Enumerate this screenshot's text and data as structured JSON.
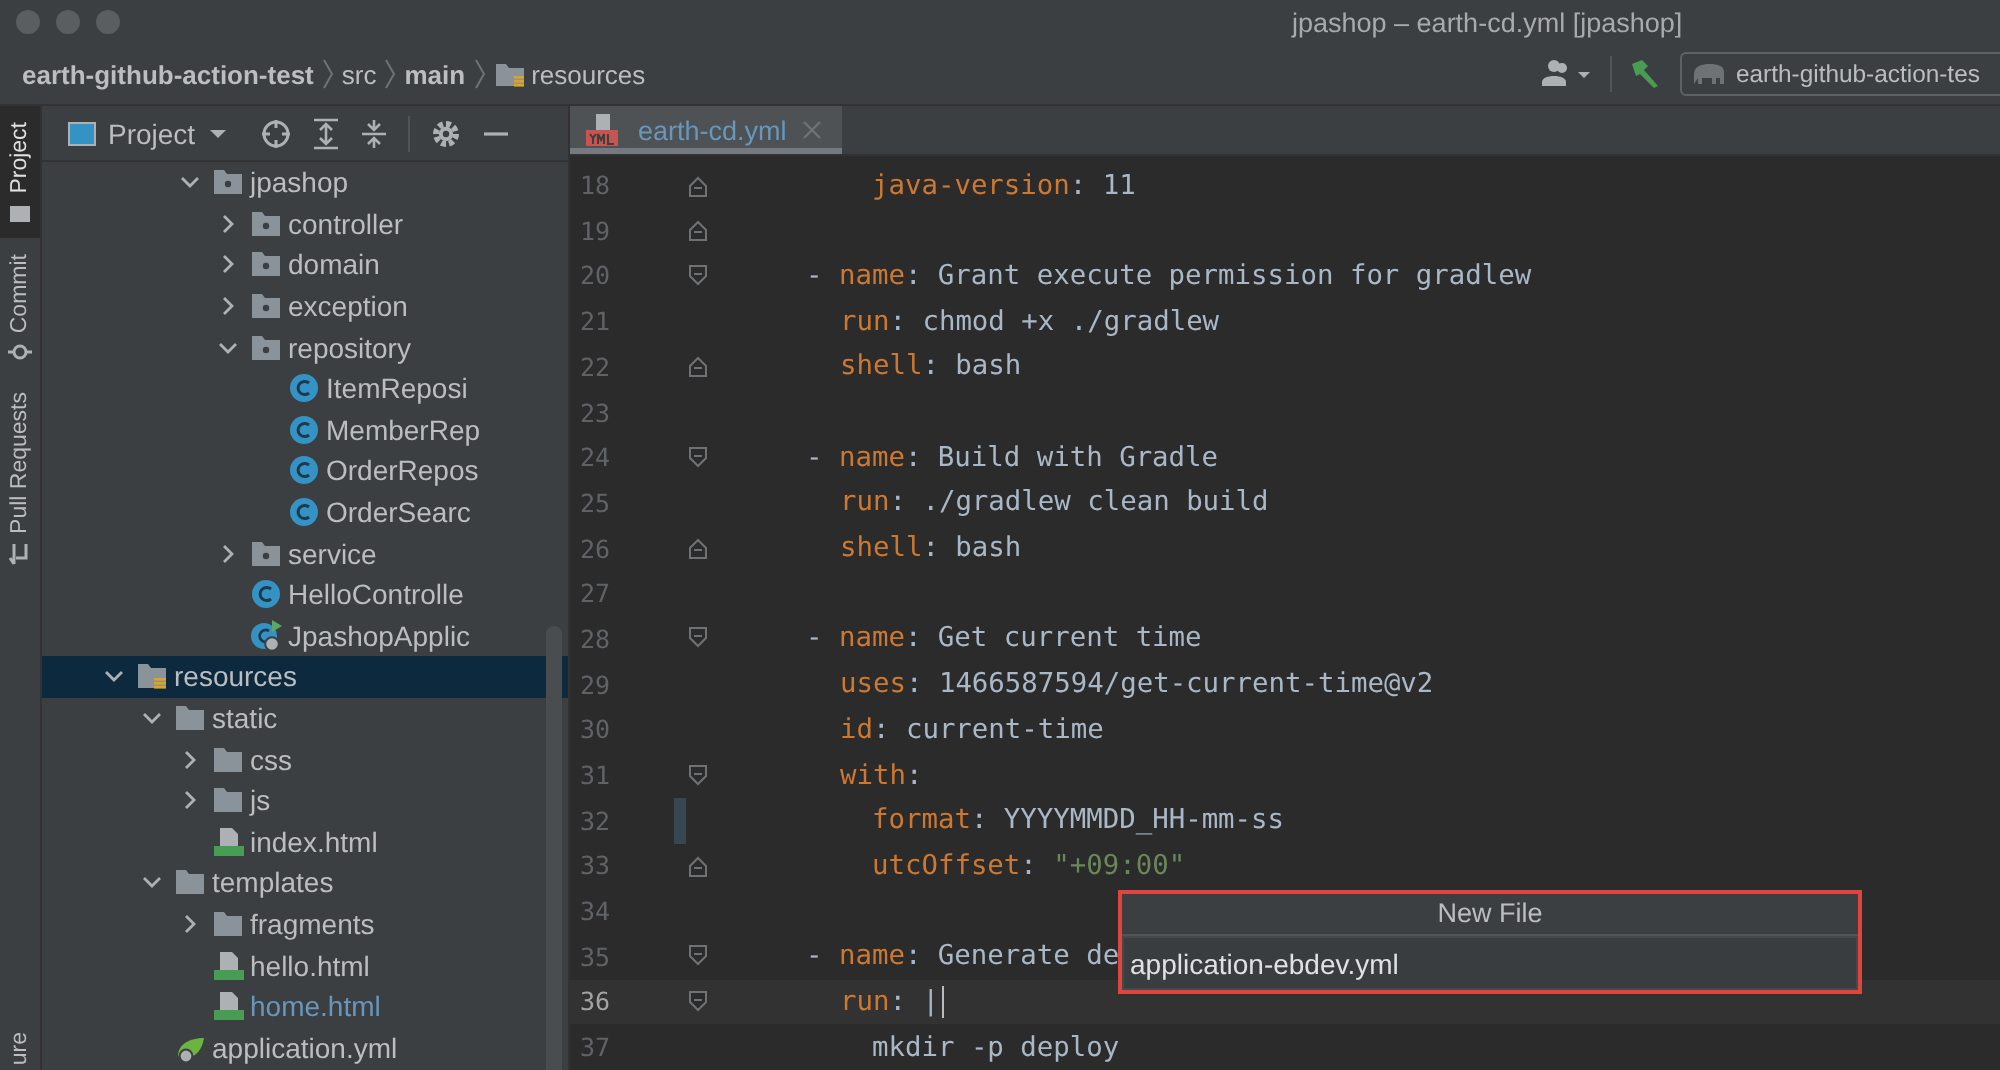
{
  "window": {
    "title": "jpashop – earth-cd.yml [jpashop]"
  },
  "breadcrumb": [
    {
      "label": "earth-github-action-test",
      "bold": true,
      "kind": "text"
    },
    {
      "label": "src",
      "bold": false,
      "kind": "text"
    },
    {
      "label": "main",
      "bold": true,
      "kind": "text"
    },
    {
      "label": "resources",
      "bold": false,
      "kind": "resources"
    }
  ],
  "run_config": {
    "label": "earth-github-action-tes"
  },
  "tool_strip": [
    {
      "label": "Project",
      "selected": true,
      "kind": "project"
    },
    {
      "label": "Commit",
      "selected": false,
      "kind": "commit"
    },
    {
      "label": "Pull Requests",
      "selected": false,
      "kind": "pull"
    },
    {
      "label": "ure",
      "selected": false,
      "kind": "none"
    }
  ],
  "project_panel": {
    "title": "Project",
    "tree": [
      {
        "children": [
          {
            "children": [
              {
                "label": "jpashop",
                "kind": "package",
                "expanded": true,
                "selected": false,
                "modified": false,
                "children": [
                  {
                    "label": "controller",
                    "kind": "package",
                    "expanded": false,
                    "selected": false,
                    "modified": false
                  },
                  {
                    "label": "domain",
                    "kind": "package",
                    "expanded": false,
                    "selected": false,
                    "modified": false
                  },
                  {
                    "label": "exception",
                    "kind": "package",
                    "expanded": false,
                    "selected": false,
                    "modified": false
                  },
                  {
                    "label": "repository",
                    "kind": "package",
                    "expanded": true,
                    "selected": false,
                    "modified": false,
                    "children": [
                      {
                        "label": "ItemReposi",
                        "kind": "class",
                        "selected": false,
                        "modified": false
                      },
                      {
                        "label": "MemberRep",
                        "kind": "class",
                        "selected": false,
                        "modified": false
                      },
                      {
                        "label": "OrderRepos",
                        "kind": "class",
                        "selected": false,
                        "modified": false
                      },
                      {
                        "label": "OrderSearc",
                        "kind": "class",
                        "selected": false,
                        "modified": false
                      }
                    ]
                  },
                  {
                    "label": "service",
                    "kind": "package",
                    "expanded": false,
                    "selected": false,
                    "modified": false
                  },
                  {
                    "label": "HelloControlle",
                    "kind": "class",
                    "selected": false,
                    "modified": false
                  },
                  {
                    "label": "JpashopApplic",
                    "kind": "app",
                    "selected": false,
                    "modified": false
                  }
                ]
              }
            ]
          }
        ]
      },
      {
        "label": "resources",
        "kind": "resources",
        "expanded": true,
        "selected": true,
        "modified": false,
        "children": [
          {
            "label": "static",
            "kind": "folder",
            "expanded": true,
            "selected": false,
            "modified": false,
            "children": [
              {
                "label": "css",
                "kind": "folder",
                "expanded": false,
                "selected": false,
                "modified": false
              },
              {
                "label": "js",
                "kind": "folder",
                "expanded": false,
                "selected": false,
                "modified": false
              },
              {
                "label": "index.html",
                "kind": "html",
                "selected": false,
                "modified": false
              }
            ]
          },
          {
            "label": "templates",
            "kind": "folder",
            "expanded": true,
            "selected": false,
            "modified": false,
            "children": [
              {
                "label": "fragments",
                "kind": "folder",
                "expanded": false,
                "selected": false,
                "modified": false
              },
              {
                "label": "hello.html",
                "kind": "html",
                "selected": false,
                "modified": false
              },
              {
                "label": "home.html",
                "kind": "html",
                "selected": false,
                "modified": true
              }
            ]
          },
          {
            "label": "application.yml",
            "kind": "spring",
            "selected": false,
            "modified": false
          }
        ]
      }
    ]
  },
  "editor": {
    "tabs": [
      {
        "label": "earth-cd.yml",
        "selected": true,
        "modified": true
      }
    ],
    "lines": [
      {
        "number": "18",
        "fold_start": false,
        "fold_end": true,
        "current": false,
        "changed": false,
        "kind": "sub",
        "tokens": [
          {
            "kind": "key",
            "text": "java-version"
          },
          {
            "kind": "plain",
            "text": ": 11"
          }
        ]
      },
      {
        "number": "19",
        "fold_start": false,
        "fold_end": true,
        "current": false,
        "changed": false,
        "kind": "blank"
      },
      {
        "number": "20",
        "fold_start": true,
        "fold_end": false,
        "current": false,
        "changed": false,
        "kind": "item",
        "tokens": [
          {
            "kind": "plain",
            "text": "- "
          },
          {
            "kind": "key",
            "text": "name"
          },
          {
            "kind": "plain",
            "text": ": Grant execute permission for gradlew"
          }
        ]
      },
      {
        "number": "21",
        "fold_start": false,
        "fold_end": false,
        "current": false,
        "changed": false,
        "kind": "field",
        "tokens": [
          {
            "kind": "key",
            "text": "run"
          },
          {
            "kind": "plain",
            "text": ": chmod +x ./gradlew"
          }
        ]
      },
      {
        "number": "22",
        "fold_start": false,
        "fold_end": true,
        "current": false,
        "changed": false,
        "kind": "field",
        "tokens": [
          {
            "kind": "key",
            "text": "shell"
          },
          {
            "kind": "plain",
            "text": ": bash"
          }
        ]
      },
      {
        "number": "23",
        "fold_start": false,
        "fold_end": false,
        "current": false,
        "changed": false,
        "kind": "blank"
      },
      {
        "number": "24",
        "fold_start": true,
        "fold_end": false,
        "current": false,
        "changed": false,
        "kind": "item",
        "tokens": [
          {
            "kind": "plain",
            "text": "- "
          },
          {
            "kind": "key",
            "text": "name"
          },
          {
            "kind": "plain",
            "text": ": Build with Gradle"
          }
        ]
      },
      {
        "number": "25",
        "fold_start": false,
        "fold_end": false,
        "current": false,
        "changed": false,
        "kind": "field",
        "tokens": [
          {
            "kind": "key",
            "text": "run"
          },
          {
            "kind": "plain",
            "text": ": ./gradlew clean build"
          }
        ]
      },
      {
        "number": "26",
        "fold_start": false,
        "fold_end": true,
        "current": false,
        "changed": false,
        "kind": "field",
        "tokens": [
          {
            "kind": "key",
            "text": "shell"
          },
          {
            "kind": "plain",
            "text": ": bash"
          }
        ]
      },
      {
        "number": "27",
        "fold_start": false,
        "fold_end": false,
        "current": false,
        "changed": false,
        "kind": "blank"
      },
      {
        "number": "28",
        "fold_start": true,
        "fold_end": false,
        "current": false,
        "changed": false,
        "kind": "item",
        "tokens": [
          {
            "kind": "plain",
            "text": "- "
          },
          {
            "kind": "key",
            "text": "name"
          },
          {
            "kind": "plain",
            "text": ": Get current time"
          }
        ]
      },
      {
        "number": "29",
        "fold_start": false,
        "fold_end": false,
        "current": false,
        "changed": false,
        "kind": "field",
        "tokens": [
          {
            "kind": "key",
            "text": "uses"
          },
          {
            "kind": "plain",
            "text": ": 1466587594/get-current-time@v2"
          }
        ]
      },
      {
        "number": "30",
        "fold_start": false,
        "fold_end": false,
        "current": false,
        "changed": false,
        "kind": "field",
        "tokens": [
          {
            "kind": "key",
            "text": "id"
          },
          {
            "kind": "plain",
            "text": ": current-time"
          }
        ]
      },
      {
        "number": "31",
        "fold_start": true,
        "fold_end": false,
        "current": false,
        "changed": false,
        "kind": "field",
        "tokens": [
          {
            "kind": "key",
            "text": "with"
          },
          {
            "kind": "plain",
            "text": ":"
          }
        ]
      },
      {
        "number": "32",
        "fold_start": false,
        "fold_end": false,
        "current": false,
        "changed": true,
        "kind": "sub",
        "tokens": [
          {
            "kind": "key",
            "text": "format"
          },
          {
            "kind": "plain",
            "text": ": YYYYMMDD_HH-mm-ss"
          }
        ]
      },
      {
        "number": "33",
        "fold_start": false,
        "fold_end": true,
        "current": false,
        "changed": false,
        "kind": "sub",
        "tokens": [
          {
            "kind": "key",
            "text": "utcOffset"
          },
          {
            "kind": "plain",
            "text": ": "
          },
          {
            "kind": "string",
            "text": "\"+09:00\""
          }
        ]
      },
      {
        "number": "34",
        "fold_start": false,
        "fold_end": false,
        "current": false,
        "changed": false,
        "kind": "blank"
      },
      {
        "number": "35",
        "fold_start": true,
        "fold_end": false,
        "current": false,
        "changed": false,
        "kind": "item",
        "tokens": [
          {
            "kind": "plain",
            "text": "- "
          },
          {
            "kind": "key",
            "text": "name"
          },
          {
            "kind": "plain",
            "text": ": Generate de"
          }
        ]
      },
      {
        "number": "36",
        "fold_start": true,
        "fold_end": false,
        "current": true,
        "changed": false,
        "kind": "field",
        "tokens": [
          {
            "kind": "key",
            "text": "run"
          },
          {
            "kind": "plain",
            "text": ": |"
          }
        ]
      },
      {
        "number": "37",
        "fold_start": false,
        "fold_end": false,
        "current": false,
        "changed": false,
        "kind": "sub",
        "tokens": [
          {
            "kind": "plain",
            "text": "mkdir -p deploy"
          }
        ]
      }
    ]
  },
  "new_file_popup": {
    "title": "New File",
    "value": "application-ebdev.yml"
  }
}
